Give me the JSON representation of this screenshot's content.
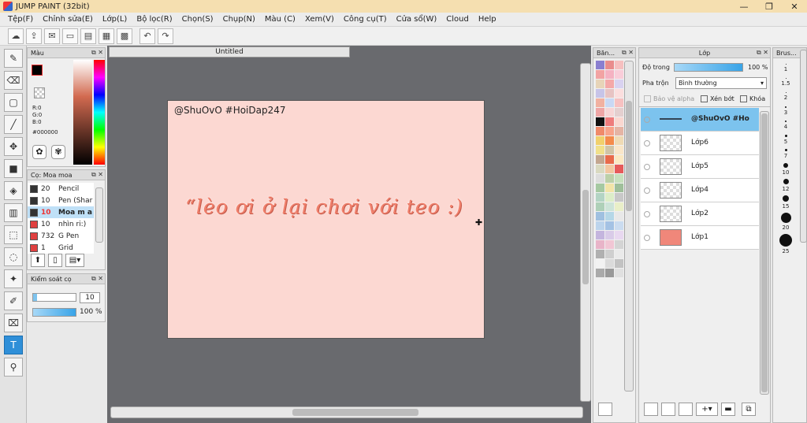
{
  "window": {
    "title": "JUMP PAINT (32bit)"
  },
  "menu": [
    "Tệp(F)",
    "Chỉnh sửa(E)",
    "Lớp(L)",
    "Bộ lọc(R)",
    "Chọn(S)",
    "Chụp(N)",
    "Màu (C)",
    "Xem(V)",
    "Công cụ(T)",
    "Cửa sổ(W)",
    "Cloud",
    "Help"
  ],
  "color_panel": {
    "title": "Màu",
    "r": "R:0",
    "g": "G:0",
    "b": "B:0",
    "hex": "#000000"
  },
  "brush_panel": {
    "title": "Cọ: Moa moa",
    "items": [
      {
        "size": "20",
        "name": "Pencil",
        "color": "#333333"
      },
      {
        "size": "10",
        "name": "Pen (Shar",
        "color": "#333333"
      },
      {
        "size": "10",
        "name": "Moa m a",
        "color": "#333333"
      },
      {
        "size": "10",
        "name": "nhìn ri:)",
        "color": "#333333"
      },
      {
        "size": "732",
        "name": "G Pen",
        "color": "#e04040"
      },
      {
        "size": "1",
        "name": "Grid",
        "color": "#e04040"
      }
    ]
  },
  "control_panel": {
    "title": "Kiểm soát cọ",
    "size_value": "10",
    "opacity_value": "100 %",
    "size_fraction": 0.1,
    "opacity_fraction": 1.0
  },
  "document": {
    "tab_title": "Untitled",
    "signature": "@ShuOvO #HoiDap247",
    "handwriting": "“lèo ơi ở lại chơi với teo :)"
  },
  "palette_panel": {
    "title": "Băn..."
  },
  "layer_panel": {
    "title": "Lớp",
    "opacity_label": "Độ trong",
    "opacity_value": "100 %",
    "blend_label": "Pha trộn",
    "blend_value": "Bình thường",
    "protect_alpha": "Bảo vệ alpha",
    "clipping": "Xén bớt",
    "lock": "Khóa",
    "layers": [
      {
        "name": "@ShuOvO #Ho",
        "selected": true
      },
      {
        "name": "Lớp6",
        "selected": false
      },
      {
        "name": "Lớp5",
        "selected": false
      },
      {
        "name": "Lớp4",
        "selected": false
      },
      {
        "name": "Lớp2",
        "selected": false
      },
      {
        "name": "Lớp1",
        "selected": false
      }
    ]
  },
  "brush_size_panel": {
    "title": "Brus...",
    "sizes": [
      "1",
      "1.5",
      "2",
      "3",
      "4",
      "5",
      "7",
      "10",
      "12",
      "15",
      "20",
      "25"
    ]
  }
}
